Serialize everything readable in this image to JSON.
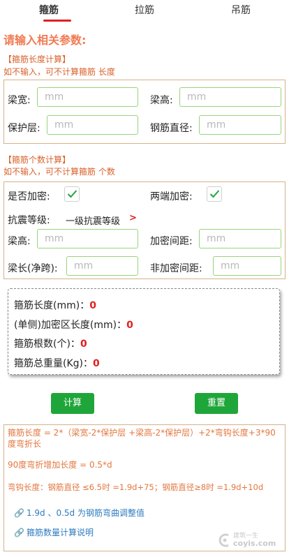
{
  "tabs": [
    {
      "label": "箍筋",
      "active": true
    },
    {
      "label": "拉筋",
      "active": false
    },
    {
      "label": "吊筋",
      "active": false
    }
  ],
  "prompt": "请输入相关参数:",
  "section1": {
    "title": "【箍筋长度计算】",
    "subtitle": "如不输入，可不计算箍筋 长度",
    "fields": {
      "beam_width_label": "梁宽:",
      "beam_width_placeholder": "mm",
      "beam_height_label": "梁高:",
      "beam_height_placeholder": "mm",
      "cover_label": "保护层:",
      "cover_placeholder": "mm",
      "bar_diameter_label": "钢筋直径:",
      "bar_diameter_placeholder": "mm"
    }
  },
  "section2": {
    "title": "【箍筋个数计算】",
    "subtitle": "如不输入，可不计算箍筋 个数",
    "densify_label": "是否加密:",
    "densify_checked": true,
    "both_ends_label": "两端加密:",
    "both_ends_checked": true,
    "seismic_label": "抗震等级:",
    "seismic_value": "一级抗震等级",
    "seismic_arrow": ">",
    "beam_height_label": "梁高:",
    "beam_height_placeholder": "mm",
    "dense_spacing_label": "加密间距:",
    "dense_spacing_placeholder": "mm",
    "beam_length_label": "梁长(净跨):",
    "beam_length_placeholder": "mm",
    "nondense_spacing_label": "非加密间距:",
    "nondense_spacing_placeholder": "mm"
  },
  "results": {
    "length_label": "箍筋长度(mm)：",
    "length_value": "0",
    "dense_zone_label": "(单侧)加密区长度(mm)：",
    "dense_zone_value": "0",
    "count_label": "箍筋根数(个)：",
    "count_value": "0",
    "weight_label": "箍筋总重量(Kg)：",
    "weight_value": "0"
  },
  "buttons": {
    "calculate": "计算",
    "reset": "重置"
  },
  "formulas": {
    "line1": "箍筋长度 = 2*（梁宽-2*保护层 +梁高-2*保护层）+2*弯钩长度+3*90度弯折长",
    "line2": "90度弯折增加长度 = 0.5*d",
    "line3": "弯钩长度：钢筋直径 ≤6.5时 =1.9d+75；钢筋直径≥8时 =1.9d+10d",
    "link1": "1.9d 、0.5d 为钢筋弯曲调整值",
    "link2": "箍筋数量计算说明"
  },
  "watermark": {
    "line1": "建筑一生",
    "line2": "coyis.com"
  },
  "colors": {
    "accent_red": "#e02020",
    "orange_text": "#d9622b",
    "button_green": "#1fa63a",
    "input_border_green": "#9ad27a",
    "link_blue": "#2f7bbf"
  }
}
